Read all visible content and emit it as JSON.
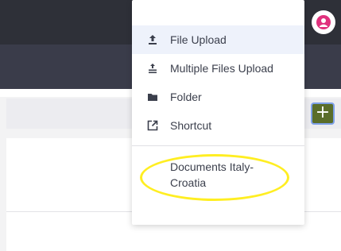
{
  "header": {
    "avatar_icon": "user-icon",
    "avatar_color": "#e0317d"
  },
  "toolbar": {
    "add_label": "+",
    "add_color": "#5a6d2a"
  },
  "menu": {
    "items": [
      {
        "label": "File Upload",
        "icon": "upload-icon"
      },
      {
        "label": "Multiple Files Upload",
        "icon": "multi-upload-icon"
      },
      {
        "label": "Folder",
        "icon": "folder-icon"
      },
      {
        "label": "Shortcut",
        "icon": "shortcut-icon"
      }
    ],
    "recent": {
      "label": "Documents Italy-Croatia"
    }
  },
  "colors": {
    "highlight": "#ffee22",
    "menu_text": "#3b3f4c",
    "topbar": "#2e3038"
  }
}
